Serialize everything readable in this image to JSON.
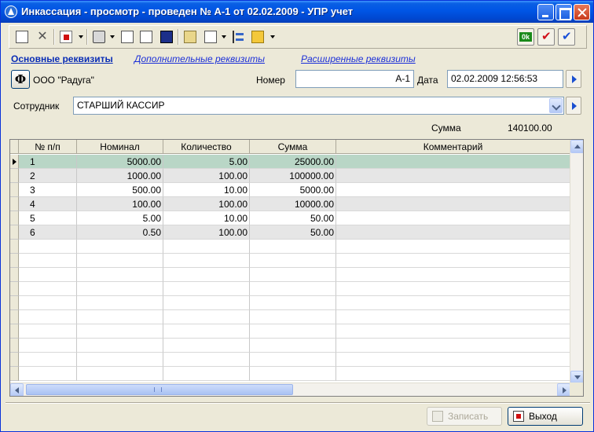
{
  "window": {
    "title": "Инкассация - просмотр - проведен № А-1 от 02.02.2009 - УПР учет"
  },
  "tabs": [
    {
      "label": "Основные реквизиты",
      "active": true
    },
    {
      "label": "Дополнительные реквизиты",
      "active": false
    },
    {
      "label": "Расширенные реквизиты",
      "active": false
    }
  ],
  "header": {
    "f_button": "Ф",
    "organization": "ООО \"Радуга\"",
    "number_label": "Номер",
    "number_value": "А-1",
    "date_label": "Дата",
    "date_value": "02.02.2009 12:56:53",
    "employee_label": "Сотрудник",
    "employee_value": "СТАРШИЙ КАССИР",
    "sum_label": "Сумма",
    "sum_value": "140100.00"
  },
  "toolbar": {
    "ok_label": "0k",
    "icons": [
      "new-doc-icon",
      "delete-icon",
      "import-icon",
      "print-icon",
      "copy-icon",
      "properties-icon",
      "book-icon",
      "folder-icon",
      "mail-icon",
      "tree-icon",
      "envelope-icon",
      "ok-icon",
      "check-red-icon",
      "check-blue-icon"
    ]
  },
  "table": {
    "columns": [
      "№ п/п",
      "Номинал",
      "Количество",
      "Сумма",
      "Комментарий"
    ],
    "rows": [
      {
        "n": "1",
        "nominal": "5000.00",
        "qty": "5.00",
        "sum": "25000.00",
        "comment": ""
      },
      {
        "n": "2",
        "nominal": "1000.00",
        "qty": "100.00",
        "sum": "100000.00",
        "comment": ""
      },
      {
        "n": "3",
        "nominal": "500.00",
        "qty": "10.00",
        "sum": "5000.00",
        "comment": ""
      },
      {
        "n": "4",
        "nominal": "100.00",
        "qty": "100.00",
        "sum": "10000.00",
        "comment": ""
      },
      {
        "n": "5",
        "nominal": "5.00",
        "qty": "10.00",
        "sum": "50.00",
        "comment": ""
      },
      {
        "n": "6",
        "nominal": "0.50",
        "qty": "100.00",
        "sum": "50.00",
        "comment": ""
      }
    ],
    "selected_row": 0
  },
  "footer": {
    "save_label": "Записать",
    "exit_label": "Выход"
  },
  "colors": {
    "selected_row": "#b9d6c6",
    "alt_row": "#e6e6e6",
    "titlebar": "#0055e5"
  }
}
